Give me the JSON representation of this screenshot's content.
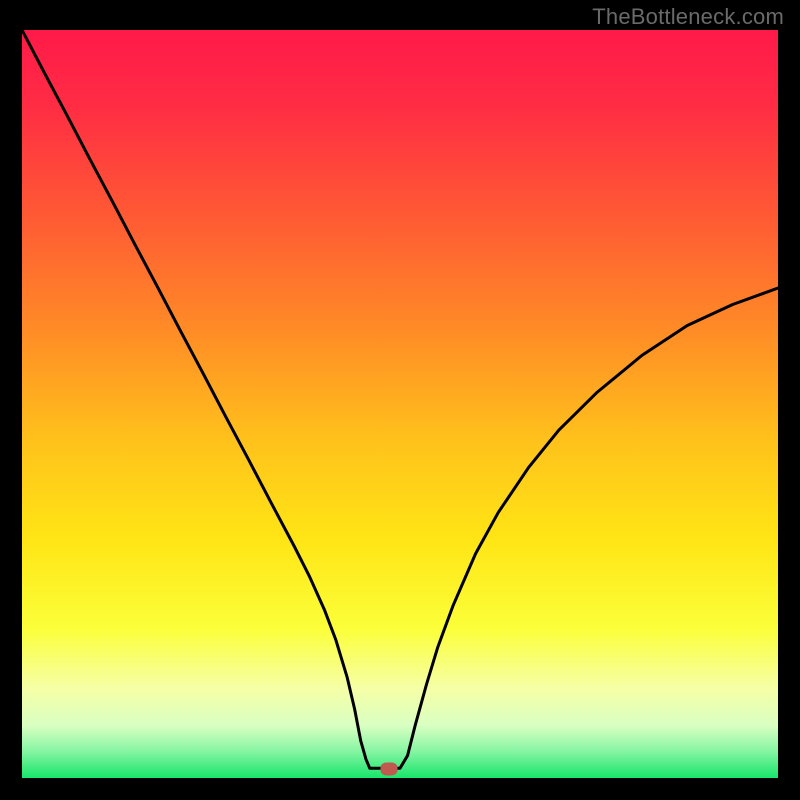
{
  "watermark": "TheBottleneck.com",
  "chart_data": {
    "type": "line",
    "title": "",
    "xlabel": "",
    "ylabel": "",
    "xlim": [
      0,
      100
    ],
    "ylim": [
      0,
      100
    ],
    "grid": false,
    "legend": false,
    "gradient_stops": [
      {
        "offset": 0.0,
        "color": "#ff1a49"
      },
      {
        "offset": 0.1,
        "color": "#ff2c44"
      },
      {
        "offset": 0.25,
        "color": "#ff5a34"
      },
      {
        "offset": 0.4,
        "color": "#ff8b26"
      },
      {
        "offset": 0.55,
        "color": "#ffc21b"
      },
      {
        "offset": 0.68,
        "color": "#ffe515"
      },
      {
        "offset": 0.8,
        "color": "#fbff39"
      },
      {
        "offset": 0.88,
        "color": "#f6ffa6"
      },
      {
        "offset": 0.93,
        "color": "#d9ffc2"
      },
      {
        "offset": 0.965,
        "color": "#84f5a2"
      },
      {
        "offset": 1.0,
        "color": "#18e56b"
      }
    ],
    "series": [
      {
        "name": "bottleneck-curve",
        "color": "#000000",
        "x": [
          0,
          3,
          6,
          9,
          12,
          15,
          18,
          21,
          24,
          27,
          30,
          33,
          36,
          38,
          40,
          41.5,
          43,
          44,
          44.8,
          45.5,
          46,
          50,
          51,
          52,
          53.5,
          55,
          57,
          60,
          63,
          67,
          71,
          76,
          82,
          88,
          94,
          100
        ],
        "y": [
          100,
          94.2,
          88.5,
          82.7,
          77.0,
          71.2,
          65.5,
          59.7,
          54.0,
          48.2,
          42.5,
          36.7,
          31.0,
          27.0,
          22.5,
          18.5,
          13.5,
          9.2,
          5.0,
          2.5,
          1.3,
          1.3,
          3.0,
          7.0,
          12.5,
          17.5,
          23.0,
          30.0,
          35.5,
          41.5,
          46.5,
          51.5,
          56.5,
          60.5,
          63.3,
          65.5
        ]
      }
    ],
    "marker": {
      "x": 48.5,
      "y": 1.2,
      "color": "#c05a51"
    }
  }
}
